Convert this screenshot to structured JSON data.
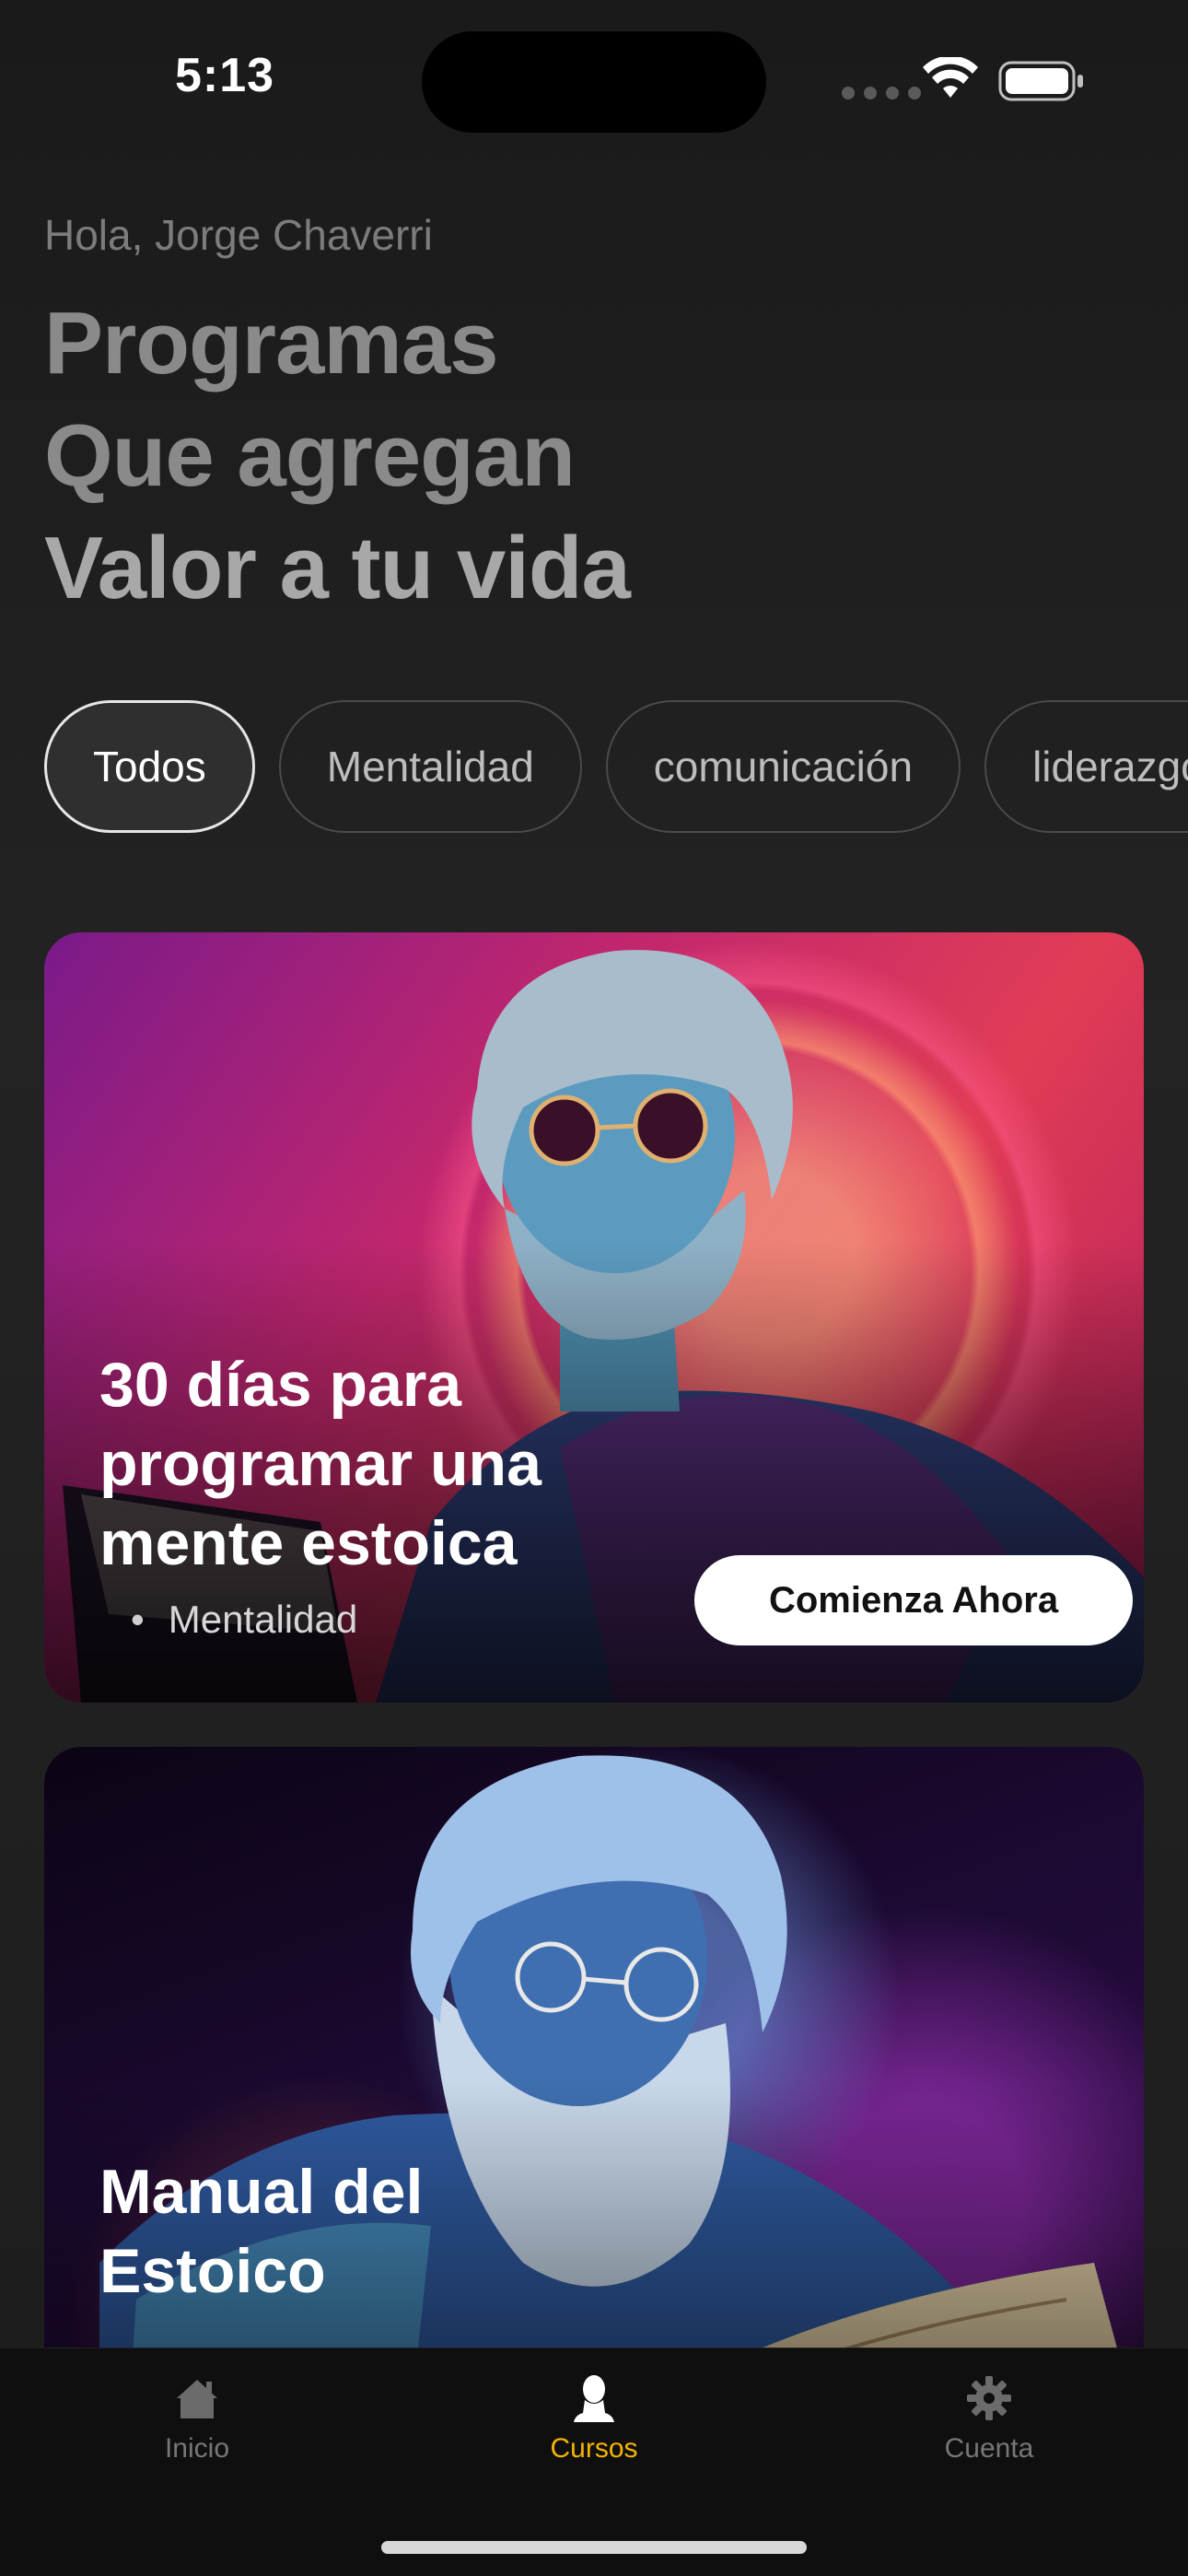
{
  "status_bar": {
    "time": "5:13",
    "icons": [
      "cellular-signal-icon",
      "wifi-icon",
      "battery-icon"
    ]
  },
  "header": {
    "greeting": "Hola, Jorge Chaverri",
    "headline_lines": [
      "Programas",
      "Que agregan",
      "Valor a tu vida"
    ]
  },
  "filters": {
    "selected": "Todos",
    "items": [
      {
        "label": "Todos"
      },
      {
        "label": "Mentalidad"
      },
      {
        "label": "comunicación"
      },
      {
        "label": "liderazgo"
      }
    ]
  },
  "courses": [
    {
      "title": "30 días para programar una mente estoica",
      "category": "Mentalidad",
      "cta": "Comienza Ahora"
    },
    {
      "title": "Manual del Estoico"
    }
  ],
  "tab_bar": {
    "active": "Cursos",
    "items": [
      {
        "label": "Inicio",
        "icon": "home-icon"
      },
      {
        "label": "Cursos",
        "icon": "bust-icon"
      },
      {
        "label": "Cuenta",
        "icon": "gear-icon"
      }
    ]
  },
  "colors": {
    "accent": "#f4b400",
    "background": "#1a1a1a",
    "chip_border": "#4a4a4a"
  }
}
